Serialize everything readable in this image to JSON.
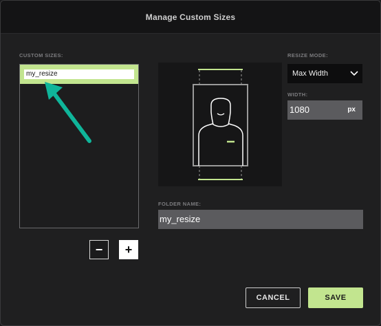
{
  "dialog": {
    "title": "Manage Custom Sizes"
  },
  "custom_sizes": {
    "label": "CUSTOM SIZES:",
    "items": [
      {
        "name": "my_resize"
      }
    ],
    "remove_label": "−",
    "add_label": "+"
  },
  "resize_mode": {
    "label": "RESIZE MODE:",
    "value": "Max Width"
  },
  "width": {
    "label": "WIDTH:",
    "value": "1080",
    "unit": "px"
  },
  "folder": {
    "label": "FOLDER NAME:",
    "value": "my_resize"
  },
  "actions": {
    "cancel": "CANCEL",
    "save": "SAVE"
  },
  "colors": {
    "accent": "#c2e58f",
    "arrow": "#0fb59a",
    "field_bg": "#5b5b5e"
  },
  "icons": {
    "arrow": "arrow-up-left-icon",
    "chevron": "chevron-down-icon",
    "preview": "person-portrait-icon"
  }
}
